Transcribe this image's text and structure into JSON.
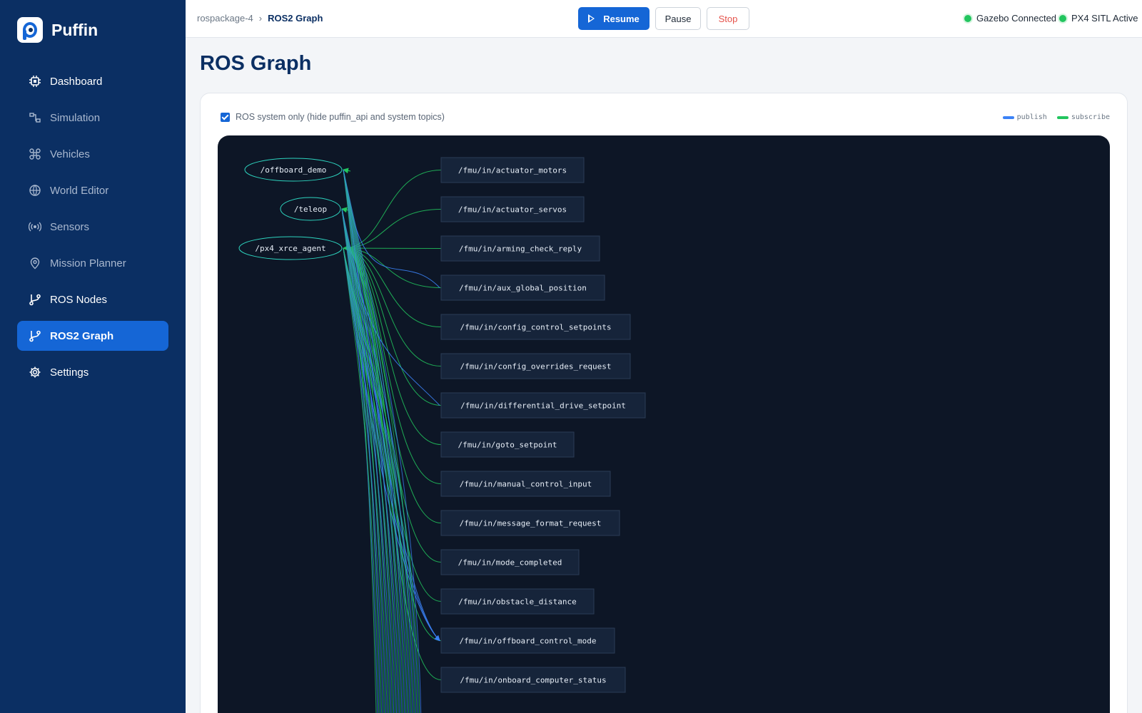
{
  "app": {
    "name": "Puffin"
  },
  "sidebar": {
    "items": [
      {
        "label": "Dashboard",
        "icon": "cpu-icon",
        "state": "normal"
      },
      {
        "label": "Simulation",
        "icon": "simulation-icon",
        "state": "dim"
      },
      {
        "label": "Vehicles",
        "icon": "drone-icon",
        "state": "dim"
      },
      {
        "label": "World Editor",
        "icon": "globe-icon",
        "state": "dim"
      },
      {
        "label": "Sensors",
        "icon": "radio-icon",
        "state": "dim"
      },
      {
        "label": "Mission Planner",
        "icon": "map-pin-icon",
        "state": "dim"
      },
      {
        "label": "ROS Nodes",
        "icon": "git-branch-icon",
        "state": "normal"
      },
      {
        "label": "ROS2 Graph",
        "icon": "git-branch-icon",
        "state": "active"
      },
      {
        "label": "Settings",
        "icon": "gear-icon",
        "state": "normal"
      }
    ]
  },
  "header": {
    "breadcrumb": {
      "parent": "rospackage-4",
      "separator": "›",
      "current": "ROS2 Graph"
    },
    "controls": {
      "resume": "Resume",
      "pause": "Pause",
      "stop": "Stop"
    },
    "status": [
      {
        "label": "Gazebo Connected",
        "color": "#22c55e"
      },
      {
        "label": "PX4 SITL Active",
        "color": "#22c55e"
      }
    ]
  },
  "main": {
    "title": "ROS Graph",
    "filter_label": "ROS system only (hide puffin_api and system topics)",
    "filter_checked": true,
    "legend": {
      "publish": "publish",
      "subscribe": "subscribe"
    }
  },
  "colors": {
    "publish": "#3b82f6",
    "subscribe": "#22c55e",
    "node_border": "#2dd4bf",
    "topic_border": "#2b3c55",
    "topic_fill": "#16243a",
    "graph_bg": "#0d1626",
    "accent": "#1566d6",
    "sidebar_bg": "#0b2f63"
  },
  "graph": {
    "nodes": [
      "/offboard_demo",
      "/teleop",
      "/px4_xrce_agent"
    ],
    "topics": [
      "/fmu/in/actuator_motors",
      "/fmu/in/actuator_servos",
      "/fmu/in/arming_check_reply",
      "/fmu/in/aux_global_position",
      "/fmu/in/config_control_setpoints",
      "/fmu/in/config_overrides_request",
      "/fmu/in/differential_drive_setpoint",
      "/fmu/in/goto_setpoint",
      "/fmu/in/manual_control_input",
      "/fmu/in/message_format_request",
      "/fmu/in/mode_completed",
      "/fmu/in/obstacle_distance",
      "/fmu/in/offboard_control_mode",
      "/fmu/in/onboard_computer_status"
    ]
  }
}
